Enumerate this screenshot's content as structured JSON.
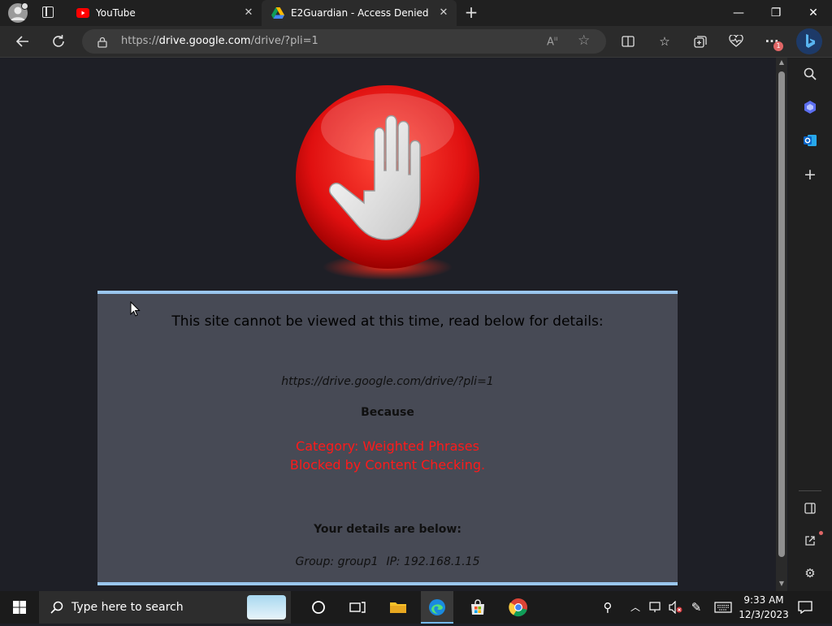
{
  "tabs": [
    {
      "title": "YouTube",
      "icon": "youtube-icon",
      "active": false
    },
    {
      "title": "E2Guardian - Access Denied",
      "icon": "google-drive-icon",
      "active": true
    }
  ],
  "address": {
    "url_prefix": "https://",
    "url_domain": "drive.google.com",
    "url_path": "/drive/?pli=1"
  },
  "page": {
    "heading": "This site cannot be viewed at this time, read below for details:",
    "blocked_url": "https://drive.google.com/drive/?pli=1",
    "because_label": "Because",
    "reason_line1": "Category: Weighted Phrases",
    "reason_line2": "Blocked by Content Checking.",
    "details_label": "Your details are below:",
    "group": "Group: group1",
    "ip": "IP: 192.168.1.15"
  },
  "toolbar": {
    "notification_count": "1"
  },
  "taskbar": {
    "search_placeholder": "Type here to search",
    "time": "9:33 AM",
    "date": "12/3/2023"
  },
  "colors": {
    "panel_bg": "#474a55",
    "panel_border": "#9ac6ef",
    "reason_red": "#ff1a1a",
    "page_bg": "#1e1f26"
  }
}
